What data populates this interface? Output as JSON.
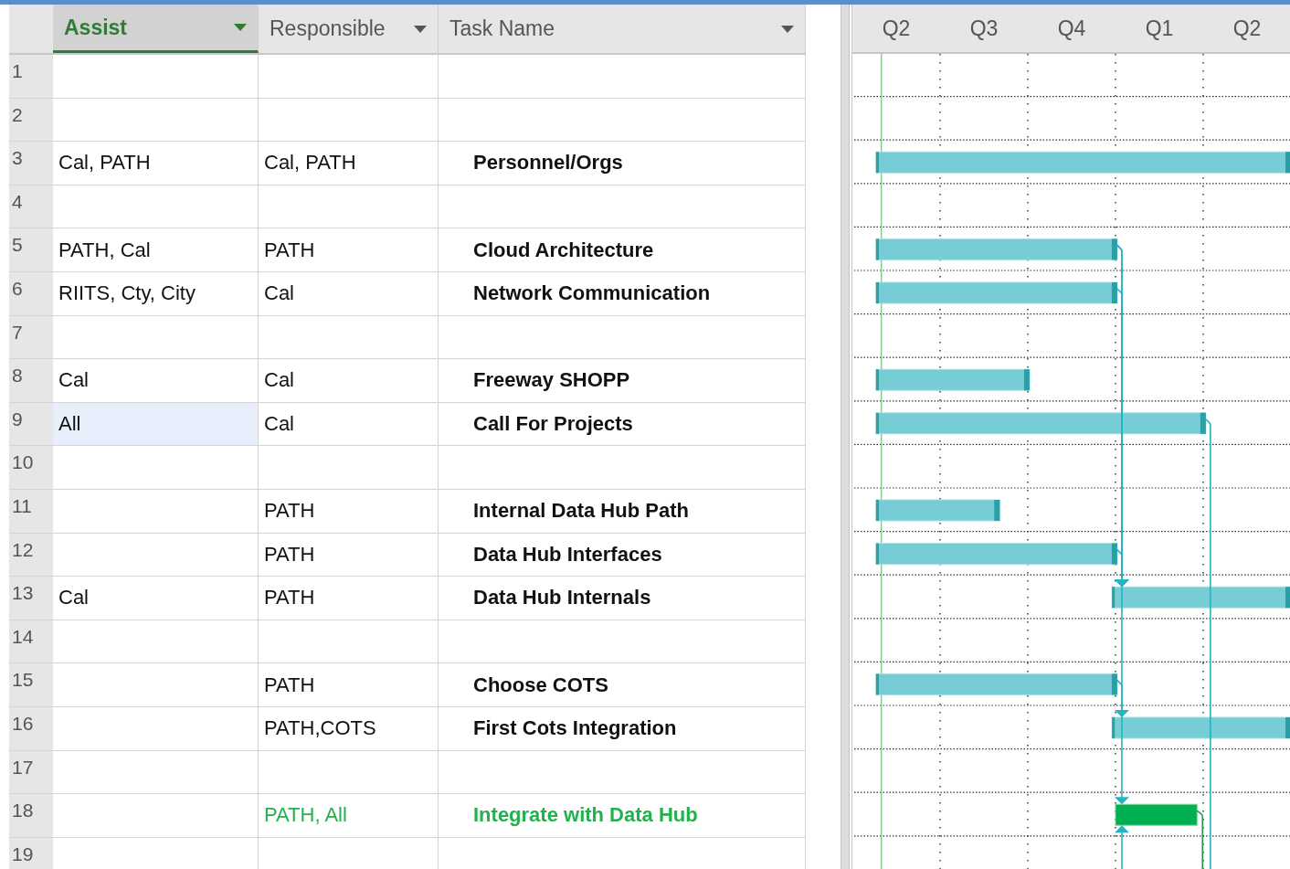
{
  "columns": [
    {
      "label": "Assist",
      "selected": true
    },
    {
      "label": "Responsible",
      "selected": false
    },
    {
      "label": "Task Name",
      "selected": false
    }
  ],
  "rows": [
    {
      "number": "1",
      "selected": false
    },
    {
      "number": "2",
      "selected": false
    },
    {
      "number": "3",
      "assist": "Cal, PATH",
      "responsible": "Cal, PATH",
      "task_name": "Personnel/Orgs",
      "selected": false,
      "critical": false
    },
    {
      "number": "4",
      "selected": false
    },
    {
      "number": "5",
      "assist": "PATH, Cal",
      "responsible": "PATH",
      "task_name": "Cloud Architecture",
      "selected": false,
      "critical": false
    },
    {
      "number": "6",
      "assist": "RIITS, Cty, City",
      "responsible": "Cal",
      "task_name": "Network Communication",
      "selected": false,
      "critical": false
    },
    {
      "number": "7",
      "selected": false
    },
    {
      "number": "8",
      "assist": "Cal",
      "responsible": "Cal",
      "task_name": "Freeway SHOPP",
      "selected": false,
      "critical": false
    },
    {
      "number": "9",
      "assist": "All",
      "responsible": "Cal",
      "task_name": "Call For Projects",
      "selected": true,
      "critical": false
    },
    {
      "number": "10",
      "selected": false
    },
    {
      "number": "11",
      "responsible": "PATH",
      "task_name": "Internal Data Hub Path",
      "selected": false,
      "critical": false
    },
    {
      "number": "12",
      "responsible": "PATH",
      "task_name": "Data Hub Interfaces",
      "selected": false,
      "critical": false
    },
    {
      "number": "13",
      "assist": "Cal",
      "responsible": "PATH",
      "task_name": "Data Hub Internals",
      "selected": false,
      "critical": false
    },
    {
      "number": "14",
      "selected": false
    },
    {
      "number": "15",
      "responsible": "PATH",
      "task_name": "Choose COTS",
      "selected": false,
      "critical": false
    },
    {
      "number": "16",
      "responsible": "PATH,COTS",
      "task_name": "First Cots Integration",
      "selected": false,
      "critical": false
    },
    {
      "number": "17",
      "selected": false
    },
    {
      "number": "18",
      "responsible": "PATH, All",
      "task_name": "Integrate with Data Hub",
      "selected": false,
      "critical": true
    },
    {
      "number": "19",
      "selected": false
    }
  ],
  "gantt": {
    "timescale": [
      "Q2",
      "Q3",
      "Q4",
      "Q1",
      "Q2"
    ]
  }
}
